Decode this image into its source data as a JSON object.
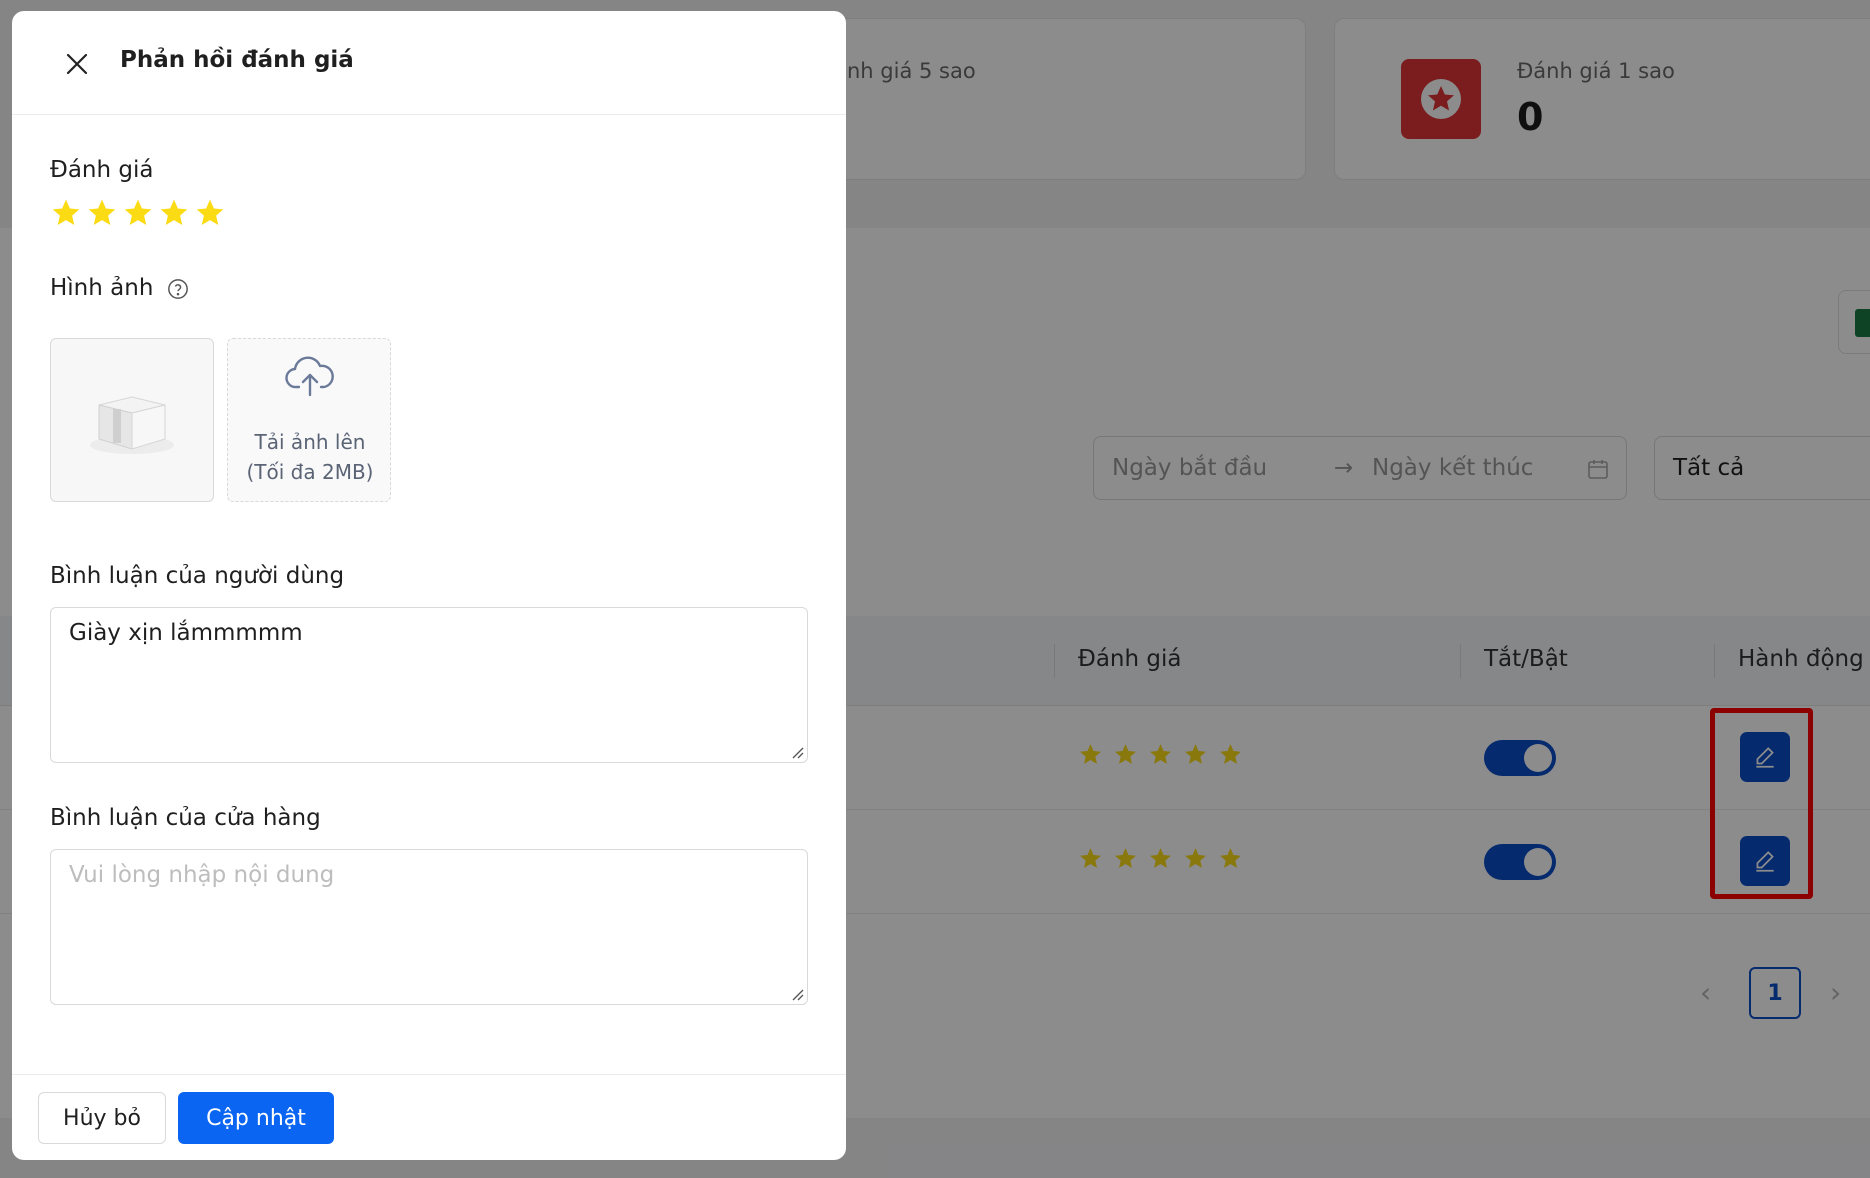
{
  "drawer": {
    "title": "Phản hồi đánh giá",
    "rating_label": "Đánh giá",
    "rating_value": 5,
    "rating_max": 5,
    "images_label": "Hình ảnh",
    "upload_line1": "Tải ảnh lên",
    "upload_line2": "(Tối đa 2MB)",
    "user_comment_label": "Bình luận của người dùng",
    "user_comment_value": "Giày xịn lắmmmmm",
    "store_comment_label": "Bình luận của cửa hàng",
    "store_comment_placeholder": "Vui lòng nhập nội dung",
    "store_comment_value": "",
    "cancel_label": "Hủy bỏ",
    "update_label": "Cập nhật"
  },
  "background": {
    "stat_5_label_partial": "nh giá 5 sao",
    "stat_1_label": "Đánh giá 1 sao",
    "stat_1_value": "0",
    "date_start_placeholder": "Ngày bắt đầu",
    "date_end_placeholder": "Ngày kết thúc",
    "status_select": "Tất cả",
    "table_headers": {
      "rating": "Đánh giá",
      "toggle": "Tắt/Bật",
      "actions": "Hành động"
    },
    "rows": [
      {
        "rating": 5,
        "enabled": true
      },
      {
        "rating": 5,
        "enabled": true
      }
    ],
    "pagination": {
      "current": "1"
    }
  },
  "colors": {
    "primary": "#0a66f2",
    "action_blue": "#0b4dc9",
    "star": "#fadb14",
    "danger": "#e0353a",
    "highlight": "#ff0000"
  }
}
